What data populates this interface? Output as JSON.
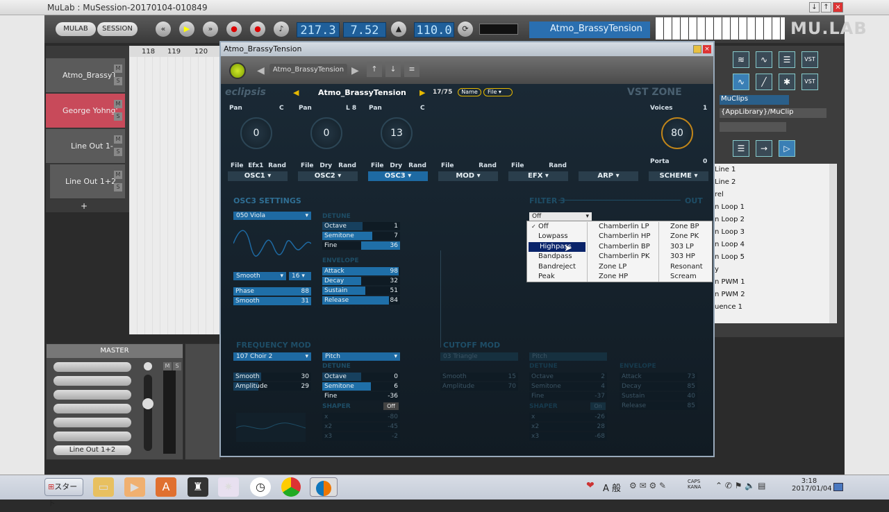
{
  "app": {
    "title": "MuLab : MuSession-20170104-010849"
  },
  "toolbar": {
    "mulab_btn": "MULAB",
    "session_btn": "SESSION",
    "position": "217.3",
    "time": "7.52",
    "tempo": "110.0",
    "preset_name": "Atmo_BrassyTension",
    "logo": "MU.LAB"
  },
  "tracks": [
    {
      "name": "Atmo_BrassyT"
    },
    {
      "name": "George Yohng'"
    },
    {
      "name": "Line Out 1-"
    },
    {
      "name": "Line Out 1+2"
    }
  ],
  "timeline": {
    "marks": [
      "118",
      "119",
      "120"
    ]
  },
  "plugin": {
    "window_title": "Atmo_BrassyTension",
    "toolbar_preset": "Atmo_BrassyTension",
    "brand": "eclipsis",
    "preset_name": "Atmo_BrassyTension",
    "preset_count": "17/75",
    "name_btn": "Name",
    "file_btn": "File",
    "vendor": "VST ZONE",
    "pans": [
      {
        "label": "Pan",
        "pos": "C",
        "value": "0"
      },
      {
        "label": "Pan",
        "pos": "L 8",
        "value": "0"
      },
      {
        "label": "Pan",
        "pos": "C",
        "value": "13"
      }
    ],
    "voices_label": "Voices",
    "voices_value": "1",
    "voices_knob": "80",
    "porta_label": "Porta",
    "porta_value": "0",
    "tab_row_labels": [
      [
        "File",
        "Efx1",
        "Rand"
      ],
      [
        "File",
        "Dry",
        "Rand"
      ],
      [
        "File",
        "Dry",
        "Rand"
      ],
      [
        "File",
        "Rand"
      ],
      [
        "File",
        "Rand"
      ]
    ],
    "tabs": [
      "OSC1",
      "OSC2",
      "OSC3",
      "MOD",
      "EFX",
      "ARP",
      "SCHEME"
    ],
    "osc3": {
      "title": "OSC3 SETTINGS",
      "wave": "050 Viola",
      "smooth_sel": "Smooth",
      "smooth_num": "16",
      "phase_label": "Phase",
      "phase_value": "88",
      "smooth_label": "Smooth",
      "smooth_value": "31",
      "detune_title": "DETUNE",
      "octave_label": "Octave",
      "octave_value": "1",
      "semitone_label": "Semitone",
      "semitone_value": "7",
      "fine_label": "Fine",
      "fine_value": "36",
      "env_title": "ENVELOPE",
      "attack_label": "Attack",
      "attack_value": "98",
      "decay_label": "Decay",
      "decay_value": "32",
      "sustain_label": "Sustain",
      "sustain_value": "51",
      "release_label": "Release",
      "release_value": "84"
    },
    "filter": {
      "title": "FILTER 3",
      "out": "OUT",
      "selected": "Off"
    },
    "dropdown": {
      "col1": [
        "Off",
        "Lowpass",
        "Highpass",
        "Bandpass",
        "Bandreject",
        "Peak"
      ],
      "col2": [
        "Chamberlin LP",
        "Chamberlin HP",
        "Chamberlin BP",
        "Chamberlin PK",
        "Zone LP",
        "Zone HP"
      ],
      "col3": [
        "Zone BP",
        "Zone PK",
        "303 LP",
        "303 HP",
        "Resonant",
        "Scream"
      ]
    },
    "freqmod": {
      "title": "FREQUENCY MOD",
      "source": "107 Choir 2",
      "target": "Pitch",
      "smooth_label": "Smooth",
      "smooth_value": "30",
      "amp_label": "Amplitude",
      "amp_value": "29",
      "detune_title": "DETUNE",
      "octave_label": "Octave",
      "octave_value": "0",
      "semitone_label": "Semitone",
      "semitone_value": "6",
      "fine_label": "Fine",
      "fine_value": "-36",
      "shaper_title": "SHAPER",
      "shaper_state": "Off",
      "x_label": "x",
      "x_value": "-80",
      "x2_label": "x2",
      "x2_value": "-45",
      "x3_label": "x3",
      "x3_value": "-2"
    },
    "cutoffmod": {
      "title": "CUTOFF MOD",
      "source": "03 Triangle",
      "target": "Pitch",
      "smooth_label": "Smooth",
      "smooth_value": "15",
      "amp_label": "Amplitude",
      "amp_value": "70",
      "detune_title": "DETUNE",
      "octave_label": "Octave",
      "octave_value": "2",
      "semitone_label": "Semitone",
      "semitone_value": "4",
      "fine_label": "Fine",
      "fine_value": "-37",
      "shaper_title": "SHAPER",
      "shaper_state": "On",
      "x_label": "x",
      "x_value": "-26",
      "x2_label": "x2",
      "x2_value": "28",
      "x3_label": "x3",
      "x3_value": "-68",
      "env_title": "ENVELOPE",
      "attack_label": "Attack",
      "attack_value": "73",
      "decay_label": "Decay",
      "decay_value": "85",
      "sustain_label": "Sustain",
      "sustain_value": "40",
      "release_label": "Release",
      "release_value": "85"
    }
  },
  "mixer": {
    "title": "MASTER",
    "output": "Line Out 1+2",
    "m": "M",
    "s": "S"
  },
  "right_panel": {
    "muclips": "MuClips",
    "path": "{AppLibrary}/MuClip",
    "list": [
      "Line 1",
      "Line 2",
      "rel",
      "n Loop 1",
      "n Loop 2",
      "n Loop 3",
      "n Loop 4",
      "n Loop 5",
      "y",
      "n PWM 1",
      "n PWM 2",
      "uence 1"
    ]
  },
  "taskbar": {
    "start": "スタート",
    "time": "3:18",
    "date": "2017/01/04",
    "ime": "A 般"
  },
  "colors": {
    "accent": "#1e6aa3",
    "synth_bg": "#1a2935",
    "highlight": "#0a246a"
  }
}
